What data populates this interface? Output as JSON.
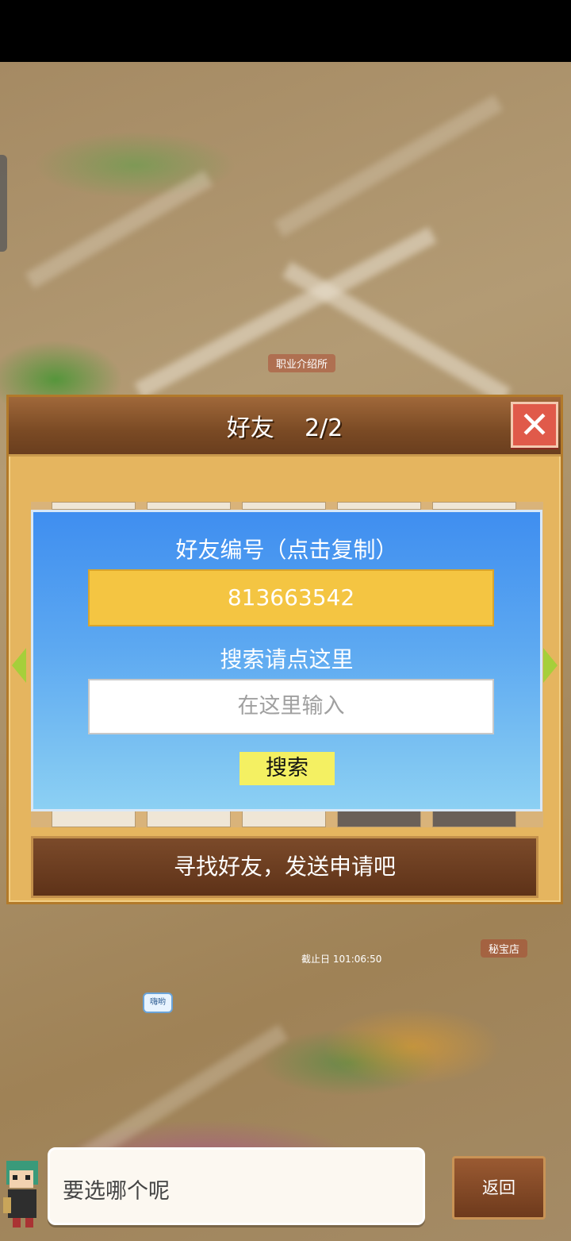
{
  "map": {
    "labels": {
      "job_agency": "职业介绍所",
      "deadline": "截止日 101:06:50",
      "treasure_shop": "秘宝店",
      "greeting_bubble": "嗨哟"
    }
  },
  "friends_panel": {
    "title": "好友",
    "count": "2/2",
    "close_icon": "close-x-icon",
    "friend_code_label": "好友编号（点击复制）",
    "friend_code": "813663542",
    "search_label": "搜索请点这里",
    "search_placeholder": "在这里输入",
    "search_button": "搜索",
    "find_friends_bar": "寻找好友，发送申请吧"
  },
  "dialog": {
    "text": "要选哪个呢",
    "back_button": "返回"
  },
  "colors": {
    "panel_wood": "#e5b55f",
    "header_brown": "#7a4a24",
    "card_blue": "#3f8ef0",
    "code_yellow": "#f4c542",
    "close_red": "#e05a4a"
  }
}
